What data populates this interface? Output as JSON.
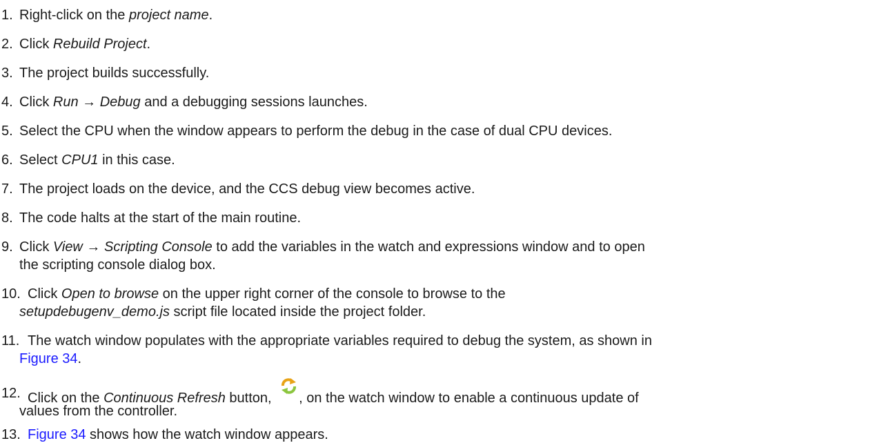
{
  "steps": [
    {
      "num": "1.",
      "parts": [
        "Right-click on the ",
        "project name",
        "."
      ]
    },
    {
      "num": "2.",
      "parts": [
        "Click ",
        "Rebuild Project",
        "."
      ]
    },
    {
      "num": "3.",
      "text": "The project builds successfully."
    },
    {
      "num": "4.",
      "parts": [
        "Click ",
        "Run → Debug",
        " and a debugging sessions launches."
      ]
    },
    {
      "num": "5.",
      "text": "Select the CPU when the window appears to perform the debug in the case of dual CPU devices."
    },
    {
      "num": "6.",
      "parts": [
        "Select ",
        "CPU1",
        " in this case."
      ]
    },
    {
      "num": "7.",
      "text": "The project loads on the device, and the CCS debug view becomes active."
    },
    {
      "num": "8.",
      "text": "The code halts at the start of the main routine."
    },
    {
      "num": "9.",
      "parts": [
        "Click ",
        "View → Scripting Console",
        " to add the variables in the watch and expressions window and to open"
      ],
      "line2": "the scripting console dialog box."
    },
    {
      "num": "10.",
      "parts": [
        "Click ",
        "Open to browse",
        " on the upper right corner of the console to browse to the"
      ],
      "line2_parts": [
        "setupdebugenv_demo.js",
        " script file located inside the project folder."
      ]
    },
    {
      "num": "11.",
      "text": "The watch window populates with the appropriate variables required to debug the system, as shown in",
      "line2_link": "Figure 34",
      "line2_after": "."
    },
    {
      "num": "12.",
      "parts": [
        "Click on the ",
        "Continuous Refresh",
        " button, ",
        ", on the watch window to enable a continuous update of"
      ],
      "line2": "values from the controller.",
      "icon": "continuous-refresh-icon"
    },
    {
      "num": "13.",
      "link": "Figure 34",
      "after": " shows how the watch window appears."
    }
  ],
  "colors": {
    "text": "#1a1a1a",
    "link": "#1a1aff",
    "icon_orange": "#e8a317",
    "icon_green": "#8cc63f"
  }
}
